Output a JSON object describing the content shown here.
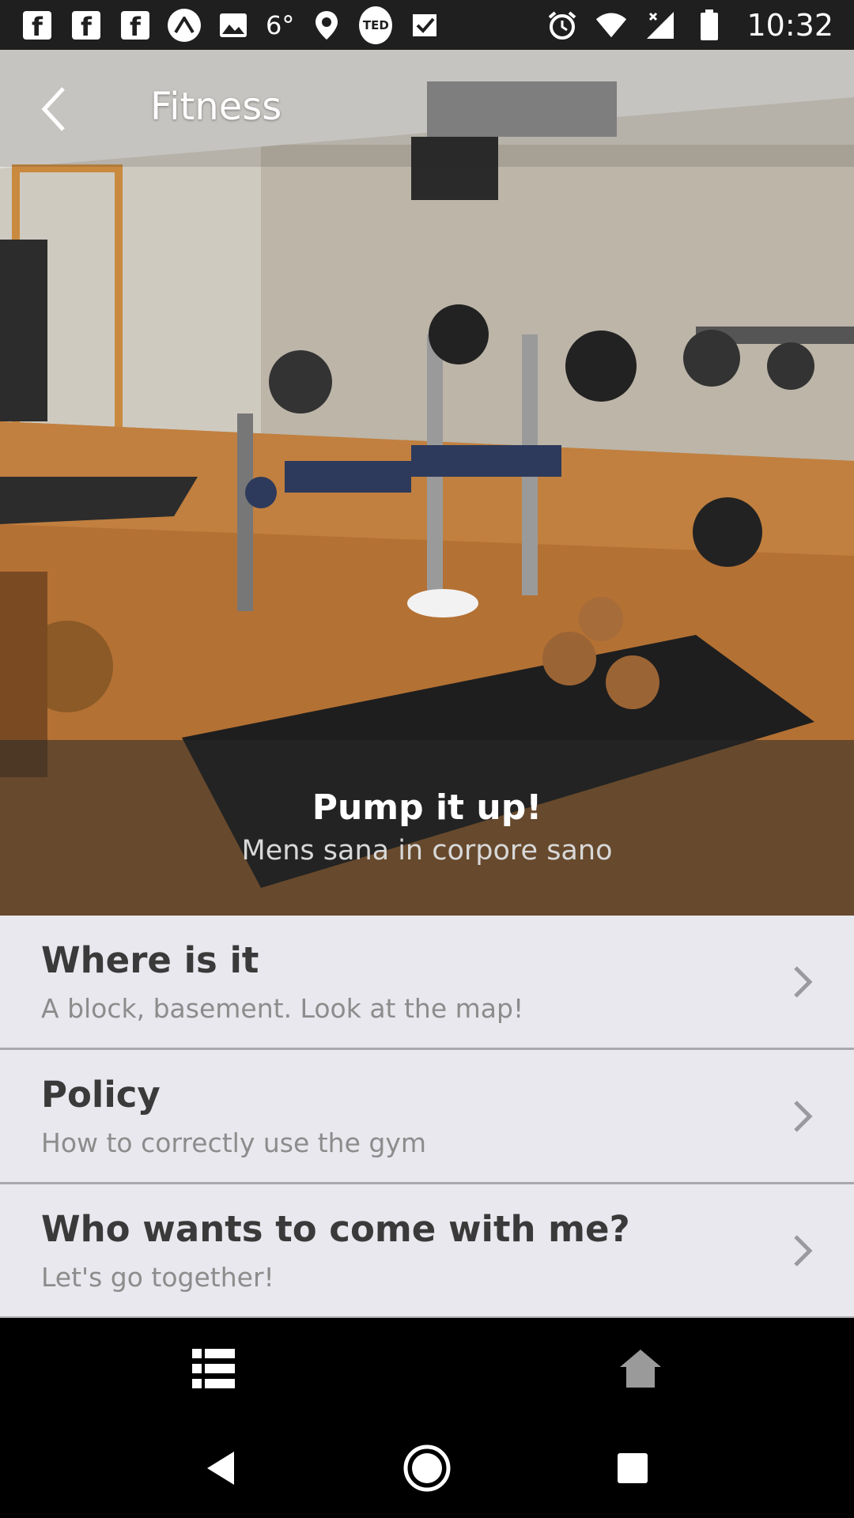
{
  "status_bar": {
    "temperature": "6°",
    "ted_label": "TED",
    "time": "10:32",
    "left_icons": [
      "facebook-icon",
      "facebook-icon",
      "facebook-icon",
      "arc-icon",
      "image-icon",
      "location-icon",
      "ted-icon",
      "check-icon"
    ],
    "right_icons": [
      "alarm-icon",
      "wifi-icon",
      "signal-icon",
      "battery-icon"
    ]
  },
  "header": {
    "title": "Fitness"
  },
  "hero": {
    "title": "Pump it up!",
    "subtitle": "Mens sana in corpore sano"
  },
  "list": {
    "items": [
      {
        "title": "Where is it",
        "subtitle": "A block, basement. Look at the map!"
      },
      {
        "title": "Policy",
        "subtitle": "How to correctly use the gym"
      },
      {
        "title": "Who wants to come with me?",
        "subtitle": "Let's go together!"
      }
    ]
  },
  "tabbar": {
    "tabs": [
      "list-icon",
      "home-icon"
    ]
  },
  "colors": {
    "status_bar": "#1f1f1f",
    "list_bg": "#e9e8ee",
    "divider": "#a9a9ad",
    "title_text": "#3a3a3a",
    "sub_text": "#8c8c8c",
    "floor": "#b06e38"
  }
}
